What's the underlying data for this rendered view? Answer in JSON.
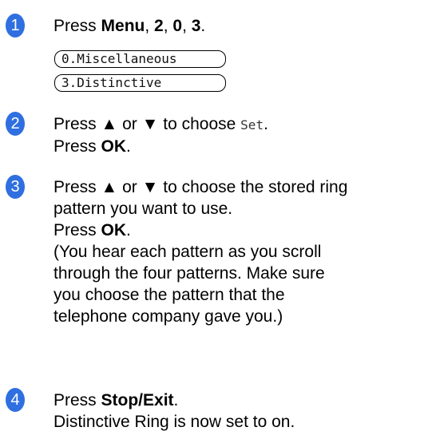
{
  "accent_color": "#2f6fe0",
  "steps": [
    {
      "number": "1",
      "press": "Press ",
      "menu": "Menu",
      "sep1": ", ",
      "k2": "2",
      "sep2": ", ",
      "k0": "0",
      "sep3": ", ",
      "k3": "3",
      "end": "."
    },
    {
      "number": "2",
      "l1a": "Press ▲ or ▼ to choose ",
      "l1code": "Set",
      "l1end": ".",
      "l2a": "Press ",
      "l2bold": "OK",
      "l2end": "."
    },
    {
      "number": "3",
      "l1": "Press ▲ or ▼ to choose the stored ring",
      "l2": "pattern you want to use.",
      "l3a": "Press ",
      "l3bold": "OK",
      "l3end": ".",
      "l4": "(You hear each pattern as you scroll",
      "l5": "through the four patterns. Make sure",
      "l6": "you choose the pattern that the",
      "l7": "telephone company gave you.)"
    },
    {
      "number": "4",
      "l1a": "Press ",
      "l1bold": "Stop/Exit",
      "l1end": ".",
      "l2": "Distinctive Ring is now set to on."
    }
  ],
  "lcd": {
    "line1": "0.Miscellaneous",
    "line2": "3.Distinctive"
  }
}
